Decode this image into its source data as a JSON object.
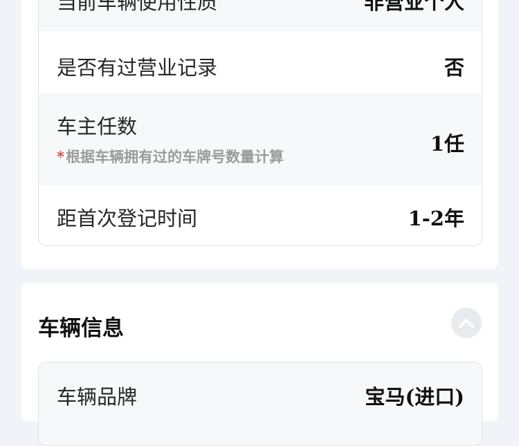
{
  "usage_section": {
    "rows": [
      {
        "label": "当前车辆使用性质",
        "value": "非营业个人"
      },
      {
        "label": "是否有过营业记录",
        "value": "否"
      },
      {
        "label": "车主任数",
        "note": "根据车辆拥有过的车牌号数量计算",
        "note_marker": "*",
        "value": "1任"
      },
      {
        "label": "距首次登记时间",
        "value": "1-2年"
      }
    ]
  },
  "vehicle_info": {
    "title": "车辆信息",
    "collapse_icon": "chevron-up-icon",
    "first_row": {
      "label": "车辆品牌",
      "value": "宝马(进口)"
    }
  }
}
